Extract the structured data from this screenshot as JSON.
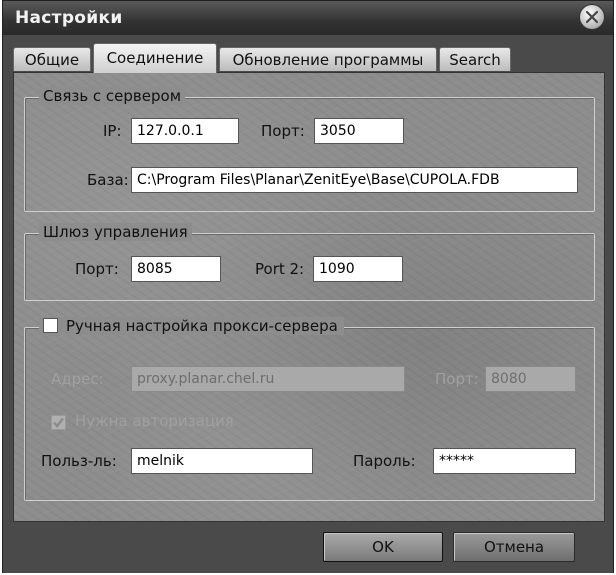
{
  "window": {
    "title": "Настройки"
  },
  "tabs": [
    {
      "label": "Общие",
      "active": false
    },
    {
      "label": "Соединение",
      "active": true
    },
    {
      "label": "Обновление программы",
      "active": false
    },
    {
      "label": "Search",
      "active": false
    }
  ],
  "server": {
    "legend": "Связь с сервером",
    "ip_label": "IP:",
    "ip_value": "127.0.0.1",
    "port_label": "Порт:",
    "port_value": "3050",
    "db_label": "База:",
    "db_value": "C:\\Program Files\\Planar\\ZenitEye\\Base\\CUPOLA.FDB"
  },
  "gateway": {
    "legend": "Шлюз управления",
    "port_label": "Порт:",
    "port_value": "8085",
    "port2_label": "Port 2:",
    "port2_value": "1090"
  },
  "proxy": {
    "checkbox_label": "Ручная настройка прокси-сервера",
    "checked": false,
    "address_label": "Адрес:",
    "address_value": "proxy.planar.chel.ru",
    "port_label": "Порт:",
    "port_value": "8080",
    "auth_label": "Нужна авторизация",
    "auth_checked": true,
    "user_label": "Польз-ль:",
    "user_value": "melnik",
    "password_label": "Пароль:",
    "password_value": "*****"
  },
  "buttons": {
    "ok": "OK",
    "cancel": "Отмена"
  },
  "icons": {
    "close": "close-icon",
    "checkmark": "checkmark-icon"
  }
}
